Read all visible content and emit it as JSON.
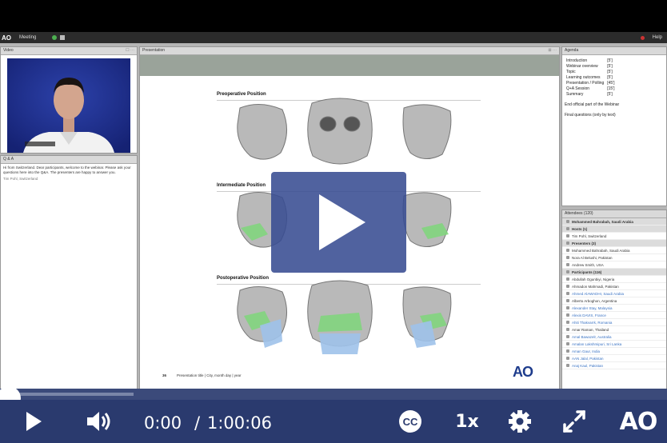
{
  "meeting": {
    "app_logo": "AO",
    "menu_label": "Meeting",
    "help_label": "Help"
  },
  "pods": {
    "video": {
      "title": "Video"
    },
    "qa": {
      "title": "Q & A",
      "message": "Hi from Switzerland. Dear participants, welcome to the webinar. Please ask your questions here into the Q&A. The presenters are happy to answer you.",
      "sender": "Tim Pohl, Switzerland"
    },
    "share": {
      "title": "Presentation"
    },
    "agenda": {
      "title": "Agenda",
      "items": [
        {
          "label": "Introduction",
          "time": "[5']"
        },
        {
          "label": "Webinar overview",
          "time": "[5']"
        },
        {
          "label": "Topic",
          "time": "[5']"
        },
        {
          "label": "Learning outcomes",
          "time": "[5']"
        },
        {
          "label": "Presentation / Polling",
          "time": "[45']"
        },
        {
          "label": "Q+A Session",
          "time": "[15']"
        },
        {
          "label": "Summary",
          "time": "[5']"
        }
      ],
      "notes": [
        "End official part of the Webinar",
        "Final questions (only by text)"
      ]
    },
    "attendees": {
      "title": "Attendees (120)",
      "rows": [
        {
          "text": "Mohammed Bahrabah, Saudi Arabia",
          "type": "group"
        },
        {
          "text": "Hosts (1)",
          "type": "group"
        },
        {
          "text": "Tim Pohl, Switzerland",
          "type": "normal"
        },
        {
          "text": "Presenters (3)",
          "type": "group"
        },
        {
          "text": "Mohammed Bahrabah, Saudi Arabia",
          "type": "normal"
        },
        {
          "text": "Nora Al Belushi, Pakistan",
          "type": "normal"
        },
        {
          "text": "Andrew Smith, USA",
          "type": "normal"
        },
        {
          "text": "Participants (116)",
          "type": "group"
        },
        {
          "text": "Abdullah Ogunbiyi, Nigeria",
          "type": "normal"
        },
        {
          "text": "Ahmadon Mahmadi, Pakistan",
          "type": "normal"
        },
        {
          "text": "Ahmed AlAWADHI, Saudi Arabia",
          "type": "blue"
        },
        {
          "text": "Alberto Arboghon, Argentina",
          "type": "normal"
        },
        {
          "text": "Alexander Stay, Malaysia",
          "type": "blue"
        },
        {
          "text": "Alexis DAVIS, France",
          "type": "blue"
        },
        {
          "text": "Ahiti Thakvarrk, Romania",
          "type": "blue"
        },
        {
          "text": "Amar Raman, Thailand",
          "type": "normal"
        },
        {
          "text": "Amal Bawazelr, Australia",
          "type": "blue"
        },
        {
          "text": "Amalan Lakshmipuri, Sri Lanka",
          "type": "blue"
        },
        {
          "text": "Aman Gaur, India",
          "type": "blue"
        },
        {
          "text": "AAN Jalal, Pakistan",
          "type": "blue"
        },
        {
          "text": "Anaj Kaul, Pakistan",
          "type": "blue"
        }
      ]
    }
  },
  "slide": {
    "section_titles": [
      "Preoperative Position",
      "Intermediate Position",
      "Postoperative Position"
    ],
    "footer": "Presentation title | City, month day | year",
    "footer_number": "36",
    "logo": "AO"
  },
  "player": {
    "current_time": "0:00",
    "separator": "/",
    "duration": "1:00:06",
    "cc_label": "CC",
    "speed_label": "1x",
    "brand": "AO",
    "progress": 0.0,
    "buffered": 0.2,
    "colors": {
      "bar": "#2a3a6e",
      "overlay": "#384c92",
      "track": "#3b4a7a"
    }
  }
}
